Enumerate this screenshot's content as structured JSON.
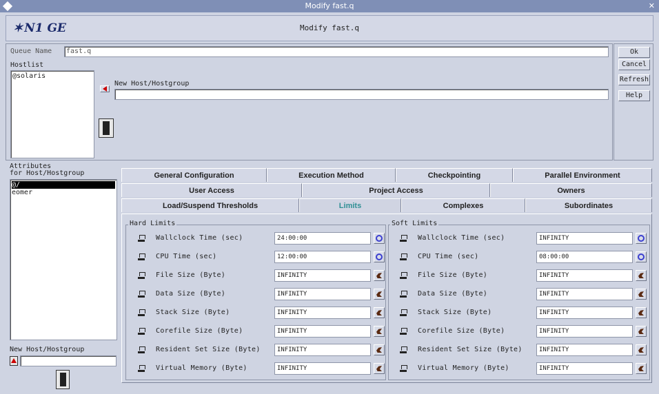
{
  "window": {
    "title": "Modify fast.q"
  },
  "header": {
    "logo": "N1 GE",
    "title": "Modify fast.q"
  },
  "queue": {
    "name_label": "Queue Name",
    "name_value": "fast.q"
  },
  "hostlist": {
    "label": "Hostlist",
    "items": [
      "@solaris"
    ]
  },
  "new_host": {
    "label": "New Host/Hostgroup",
    "value": ""
  },
  "buttons": {
    "ok": "Ok",
    "cancel": "Cancel",
    "refresh": "Refresh",
    "help": "Help"
  },
  "attributes": {
    "label_line1": "Attributes",
    "label_line2": "for Host/Hostgroup",
    "items": [
      "@/",
      "eomer"
    ],
    "selected_index": 0
  },
  "bottom_new_host": {
    "label": "New Host/Hostgroup",
    "value": ""
  },
  "tabs": {
    "row1": [
      "General Configuration",
      "Execution Method",
      "Checkpointing",
      "Parallel Environment"
    ],
    "row2": [
      "User Access",
      "Project Access",
      "Owners"
    ],
    "row3": [
      "Load/Suspend Thresholds",
      "Limits",
      "Complexes",
      "Subordinates"
    ],
    "active": "Limits"
  },
  "hard_limits": {
    "title": "Hard Limits",
    "rows": [
      {
        "label": "Wallclock Time (sec)",
        "value": "24:00:00",
        "button": "clock-icon"
      },
      {
        "label": "CPU Time (sec)",
        "value": "12:00:00",
        "button": "clock-icon"
      },
      {
        "label": "File Size (Byte)",
        "value": "INFINITY",
        "button": "runner-icon"
      },
      {
        "label": "Data Size (Byte)",
        "value": "INFINITY",
        "button": "runner-icon"
      },
      {
        "label": "Stack Size (Byte)",
        "value": "INFINITY",
        "button": "runner-icon"
      },
      {
        "label": "Corefile Size (Byte)",
        "value": "INFINITY",
        "button": "runner-icon"
      },
      {
        "label": "Resident Set Size (Byte)",
        "value": "INFINITY",
        "button": "runner-icon"
      },
      {
        "label": "Virtual Memory (Byte)",
        "value": "INFINITY",
        "button": "runner-icon"
      }
    ]
  },
  "soft_limits": {
    "title": "Soft Limits",
    "rows": [
      {
        "label": "Wallclock Time (sec)",
        "value": "INFINITY",
        "button": "clock-icon"
      },
      {
        "label": "CPU Time (sec)",
        "value": "08:00:00",
        "button": "clock-icon"
      },
      {
        "label": "File Size (Byte)",
        "value": "INFINITY",
        "button": "runner-icon"
      },
      {
        "label": "Data Size (Byte)",
        "value": "INFINITY",
        "button": "runner-icon"
      },
      {
        "label": "Stack Size (Byte)",
        "value": "INFINITY",
        "button": "runner-icon"
      },
      {
        "label": "Corefile Size (Byte)",
        "value": "INFINITY",
        "button": "runner-icon"
      },
      {
        "label": "Resident Set Size (Byte)",
        "value": "INFINITY",
        "button": "runner-icon"
      },
      {
        "label": "Virtual Memory (Byte)",
        "value": "INFINITY",
        "button": "runner-icon"
      }
    ]
  },
  "colors": {
    "title_bar": "#7f8fb6",
    "background": "#cfd4e2",
    "active_tab": "#2f8f94",
    "logo": "#1b2a6b"
  }
}
